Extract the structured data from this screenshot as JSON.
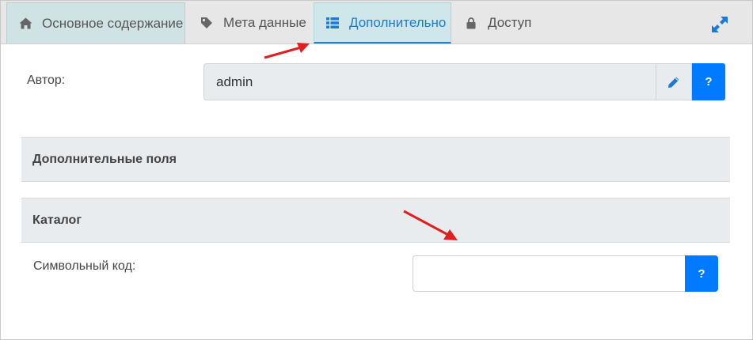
{
  "tabs": [
    {
      "label": "Основное содержание",
      "icon": "home-icon"
    },
    {
      "label": "Мета данные",
      "icon": "tag-icon"
    },
    {
      "label": "Дополнительно",
      "icon": "list-icon",
      "active": true
    },
    {
      "label": "Доступ",
      "icon": "lock-icon"
    }
  ],
  "toolbar": {
    "expand_icon": "expand-icon"
  },
  "author": {
    "label": "Автор:",
    "value": "admin",
    "edit_icon": "pencil-icon",
    "help_label": "?"
  },
  "sections": {
    "extra_fields": "Дополнительные поля",
    "catalog": "Каталог"
  },
  "symbol_code": {
    "label": "Символьный код:",
    "value": "",
    "placeholder": "",
    "help_label": "?"
  },
  "colors": {
    "accent": "#007bff",
    "active_tab_text": "#1a7ad4",
    "annotation_arrow": "#e02020"
  }
}
